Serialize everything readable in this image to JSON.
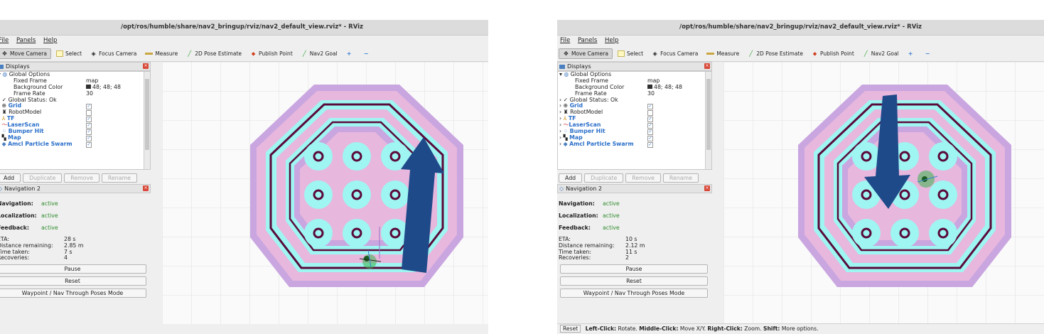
{
  "window": {
    "title": "/opt/ros/humble/share/nav2_bringup/rviz/nav2_default_view.rviz* - RViz",
    "menu": [
      "File",
      "Panels",
      "Help"
    ],
    "toolbar": [
      "Move Camera",
      "Select",
      "Focus Camera",
      "Measure",
      "2D Pose Estimate",
      "Publish Point",
      "Nav2 Goal"
    ]
  },
  "displays": {
    "title": "Displays",
    "global_options": "Global Options",
    "fixed_frame_label": "Fixed Frame",
    "fixed_frame_value": "map",
    "bg_color_label": "Background Color",
    "bg_color_value": "48; 48; 48",
    "frame_rate_label": "Frame Rate",
    "frame_rate_value": "30",
    "global_status": "Global Status: Ok",
    "items": [
      "Grid",
      "RobotModel",
      "TF",
      "LaserScan",
      "Bumper Hit",
      "Map",
      "Amcl Particle Swarm"
    ],
    "buttons": [
      "Add",
      "Duplicate",
      "Remove",
      "Rename"
    ]
  },
  "nav2": {
    "title": "Navigation 2",
    "navigation_label": "Navigation:",
    "localization_label": "Localization:",
    "feedback_label": "Feedback:",
    "status_value": "active",
    "eta_label": "ETA:",
    "dist_label": "Distance remaining:",
    "time_label": "Time taken:",
    "recov_label": "Recoveries:",
    "pause": "Pause",
    "reset": "Reset",
    "mode": "Waypoint / Nav Through Poses Mode"
  },
  "left_window": {
    "eta": "28 s",
    "distance": "2.85 m",
    "time_taken": "7 s",
    "recoveries": "4"
  },
  "right_window": {
    "eta": "10 s",
    "distance": "2.12 m",
    "time_taken": "11 s",
    "recoveries": "2"
  },
  "status_bar": {
    "reset": "Reset",
    "lc": "Left-Click:",
    "lc_t": " Rotate. ",
    "mc": "Middle-Click:",
    "mc_t": " Move X/Y. ",
    "rc": "Right-Click:",
    "rc_t": " Zoom. ",
    "sh": "Shift:",
    "sh_t": " More options."
  },
  "colors": {
    "arrow": "#1f4a8a",
    "wall": "#5a0a3a",
    "inflation_cyan": "#9ff5f2",
    "inflation_pink": "#e7b7dd",
    "inflation_purple": "#c9a6e0"
  }
}
